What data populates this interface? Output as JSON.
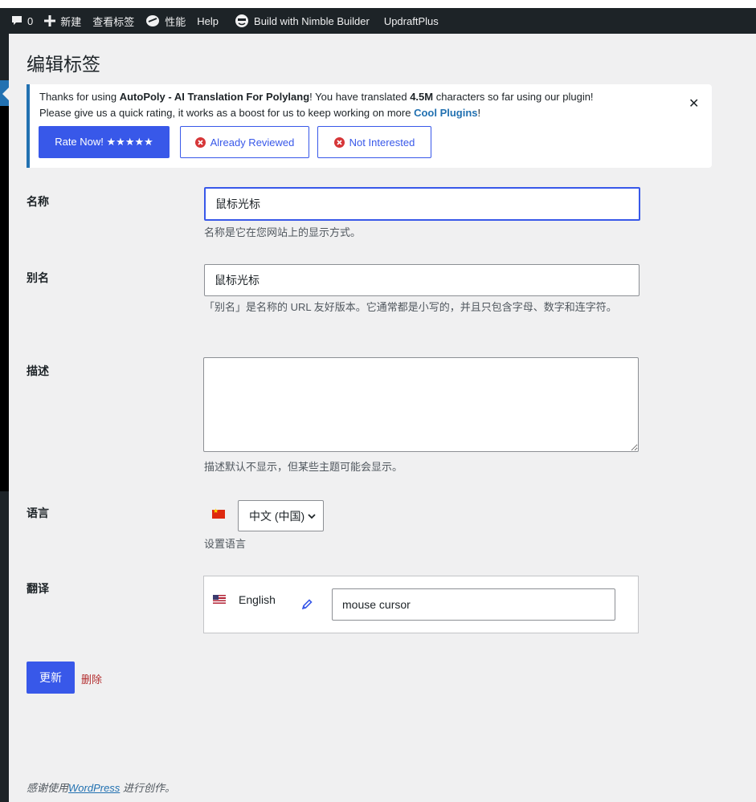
{
  "adminbar": {
    "comments_count": "0",
    "new_label": "新建",
    "view_tag_label": "查看标签",
    "performance_label": "性能",
    "help_label": "Help",
    "nimble_label": "Build with Nimble Builder",
    "updraft_label": "UpdraftPlus"
  },
  "page": {
    "title": "编辑标签"
  },
  "notice": {
    "text_thanks": "Thanks for using ",
    "plugin_name": "AutoPoly - AI Translation For Polylang",
    "text_translated": "! You have translated ",
    "chars_count": "4.5M",
    "text_chars": " characters so far using our plugin!",
    "text_please": "Please give us a quick rating, it works as a boost for us to keep working on more ",
    "cool_plugins": "Cool Plugins",
    "text_end": "!",
    "close_label": "✕",
    "rate_button": "Rate Now! ★★★★★",
    "reviewed_button": "Already Reviewed",
    "not_interested_button": "Not Interested"
  },
  "form": {
    "name_label": "名称",
    "name_value": "鼠标光标",
    "name_desc": "名称是它在您网站上的显示方式。",
    "slug_label": "别名",
    "slug_value": "鼠标光标",
    "slug_desc": "「别名」是名称的 URL 友好版本。它通常都是小写的，并且只包含字母、数字和连字符。",
    "description_label": "描述",
    "description_value": "",
    "description_desc": "描述默认不显示，但某些主题可能会显示。",
    "language_label": "语言",
    "language_selected": "中文 (中国)",
    "language_desc": "设置语言",
    "translations_label": "翻译",
    "translation_language": "English",
    "translation_value": "mouse cursor"
  },
  "actions": {
    "update_button": "更新",
    "delete_link": "删除"
  },
  "footer": {
    "prefix": "感谢使用",
    "link": "WordPress",
    "suffix": "进行创作。"
  },
  "colors": {
    "accent": "#3858e9",
    "adminbar": "#1d2327",
    "delete": "#b32d2e",
    "link": "#2271b1"
  }
}
